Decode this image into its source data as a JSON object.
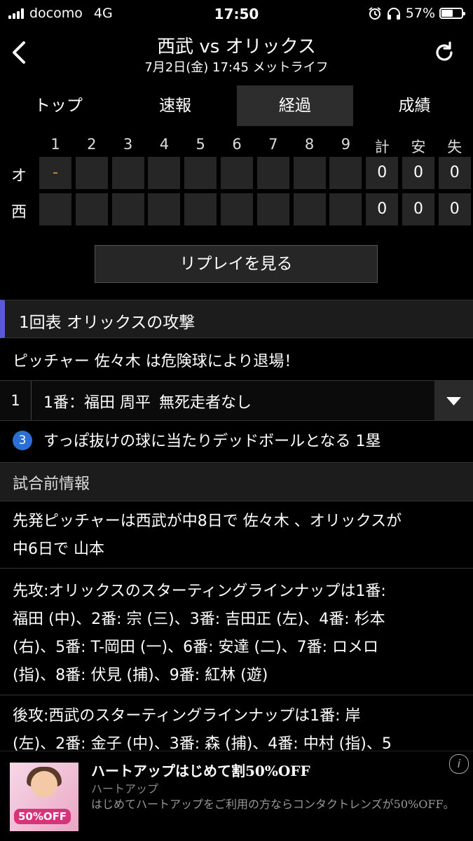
{
  "status_bar": {
    "carrier": "docomo",
    "network": "4G",
    "time": "17:50",
    "battery": "57%"
  },
  "header": {
    "title": "西武 vs オリックス",
    "subtitle": "7月2日(金) 17:45 メットライフ"
  },
  "tabs": [
    {
      "label": "トップ",
      "active": false
    },
    {
      "label": "速報",
      "active": false
    },
    {
      "label": "経過",
      "active": true
    },
    {
      "label": "成績",
      "active": false
    }
  ],
  "scoreboard": {
    "headers": [
      "1",
      "2",
      "3",
      "4",
      "5",
      "6",
      "7",
      "8",
      "9",
      "計",
      "安",
      "失"
    ],
    "rows": [
      {
        "team": "オ",
        "innings": [
          "-",
          "",
          "",
          "",
          "",
          "",
          "",
          "",
          ""
        ],
        "totals": [
          "0",
          "0",
          "0"
        ]
      },
      {
        "team": "西",
        "innings": [
          "",
          "",
          "",
          "",
          "",
          "",
          "",
          "",
          ""
        ],
        "totals": [
          "0",
          "0",
          "0"
        ]
      }
    ],
    "in_progress_color": "#e0902c"
  },
  "replay_button": "リプレイを見る",
  "inning_header": "1回表 オリックスの攻撃",
  "notice": "ピッチャー 佐々木 は危険球により退場！",
  "at_bat": {
    "number": "1",
    "batter": "1番：福田 周平",
    "situation": "無死走者なし"
  },
  "play": {
    "pitch_count": "3",
    "text": "すっぽ抜けの球に当たりデッドボールとなる 1塁"
  },
  "pregame": {
    "heading": "試合前情報",
    "paragraphs": [
      [
        "先発ピッチャーは西武が中8日で 佐々木 、オリックスが",
        "中6日で 山本"
      ],
      [
        "先攻:オリックスのスターティングラインナップは1番:",
        "福田 (中)、2番: 宗 (三)、3番: 吉田正 (左)、4番: 杉本",
        "(右)、5番: T-岡田 (一)、6番: 安達 (二)、7番: ロメロ",
        "(指)、8番: 伏見 (捕)、9番: 紅林 (遊)"
      ],
      [
        "後攻:西武のスターティングラインナップは1番: 岸",
        "(左)、2番: 金子 (中)、3番: 森 (捕)、4番: 中村 (指)、5"
      ]
    ]
  },
  "ad": {
    "title": "ハートアップはじめて割50%OFF",
    "brand": "ハートアップ",
    "description": "はじめてハートアップをご利用の方ならコンタクトレンズが50%OFF。",
    "thumb_text": "50%OFF",
    "info": "i"
  }
}
